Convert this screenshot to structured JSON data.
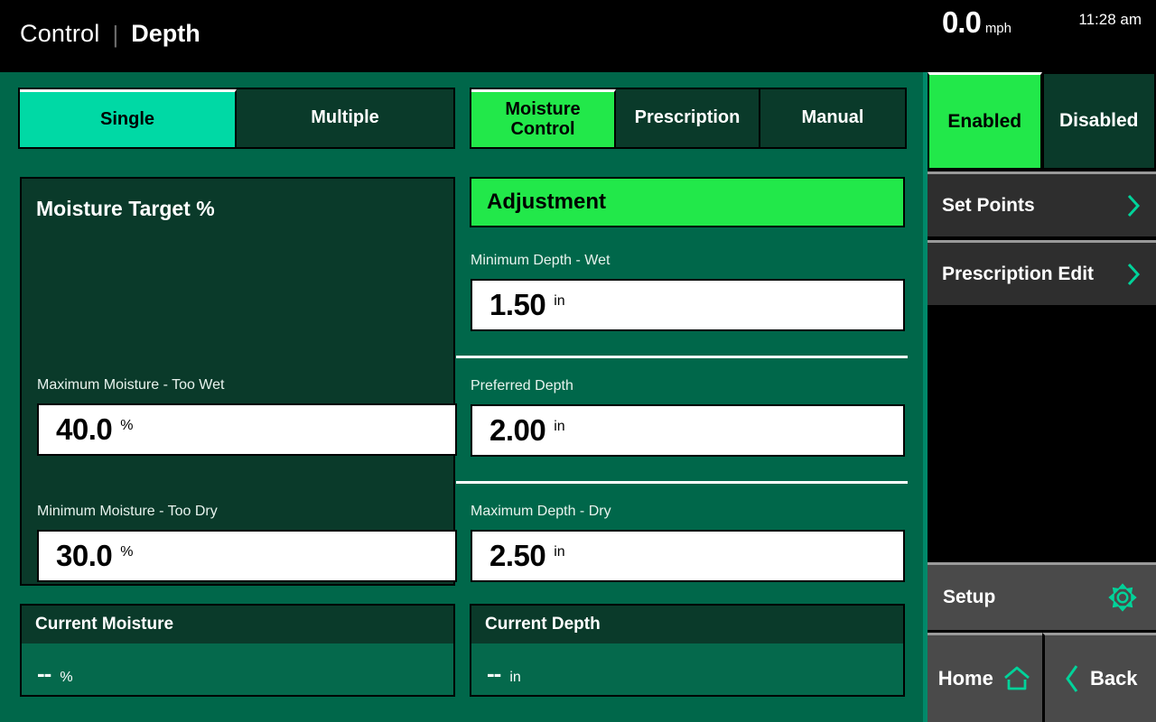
{
  "header": {
    "breadcrumb_parent": "Control",
    "breadcrumb_separator": "|",
    "breadcrumb_current": "Depth",
    "speed_value": "0.0",
    "speed_unit": "mph",
    "time": "11:28 am"
  },
  "tabs_mode": {
    "items": [
      {
        "label": "Single",
        "active": true
      },
      {
        "label": "Multiple",
        "active": false
      }
    ]
  },
  "tabs_control": {
    "items": [
      {
        "label": "Moisture\nControl",
        "line1": "Moisture",
        "line2": "Control",
        "active": true
      },
      {
        "label": "Prescription",
        "active": false
      },
      {
        "label": "Manual",
        "active": false
      }
    ]
  },
  "moisture_card": {
    "title": "Moisture Target %",
    "max_label": "Maximum Moisture - Too Wet",
    "max_value": "40.0",
    "max_unit": "%",
    "min_label": "Minimum Moisture - Too Dry",
    "min_value": "30.0",
    "min_unit": "%"
  },
  "adjustment": {
    "title": "Adjustment",
    "min_depth_label": "Minimum Depth - Wet",
    "min_depth_value": "1.50",
    "min_depth_unit": "in",
    "preferred_depth_label": "Preferred Depth",
    "preferred_depth_value": "2.00",
    "preferred_depth_unit": "in",
    "max_depth_label": "Maximum Depth - Dry",
    "max_depth_value": "2.50",
    "max_depth_unit": "in"
  },
  "current_moisture": {
    "title": "Current Moisture",
    "value": "--",
    "unit": "%"
  },
  "current_depth": {
    "title": "Current Depth",
    "value": "--",
    "unit": "in"
  },
  "sidebar": {
    "enable_toggle": [
      {
        "label": "Enabled",
        "active": true
      },
      {
        "label": "Disabled",
        "active": false
      }
    ],
    "menu": [
      {
        "label": "Set Points",
        "icon": "chevron-right-icon"
      },
      {
        "label": "Prescription Edit",
        "icon": "chevron-right-icon"
      }
    ],
    "setup": {
      "label": "Setup",
      "icon": "gear-icon"
    },
    "nav": [
      {
        "label": "Home",
        "icon": "home-icon"
      },
      {
        "label": "Back",
        "icon": "chevron-left-icon"
      }
    ]
  },
  "colors": {
    "background_green": "#00674A",
    "panel_dark_green": "#0A3A2A",
    "accent_teal": "#00D9A5",
    "accent_green": "#22E84A",
    "sidebar_gray": "#4a4a4a",
    "menu_gray": "#2e2e2e",
    "icon_teal": "#00D39A",
    "topbar_black": "#000000"
  }
}
